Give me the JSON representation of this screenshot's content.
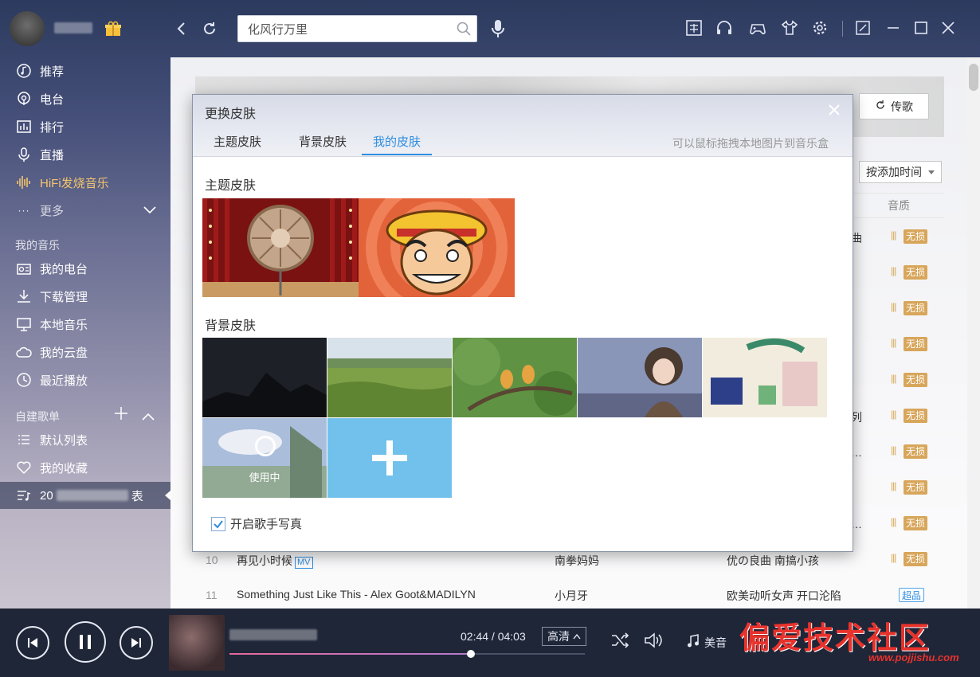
{
  "header": {
    "search_value": "化风行万里",
    "toolbar_icons": [
      "skin-icon",
      "headphone-icon",
      "gamepad-icon",
      "shirt-icon",
      "gear-icon",
      "mini-mode-icon",
      "minimize-icon",
      "maximize-icon",
      "close-icon"
    ]
  },
  "sidebar": {
    "nav": [
      {
        "label": "推荐",
        "icon": "music-disc-icon"
      },
      {
        "label": "电台",
        "icon": "radio-icon"
      },
      {
        "label": "排行",
        "icon": "chart-icon"
      },
      {
        "label": "直播",
        "icon": "mic-icon"
      },
      {
        "label": "HiFi发烧音乐",
        "icon": "waveform-icon"
      },
      {
        "label": "更多",
        "icon": "dots-icon"
      }
    ],
    "my_music_title": "我的音乐",
    "my_music": [
      {
        "label": "我的电台",
        "icon": "radio-box-icon"
      },
      {
        "label": "下载管理",
        "icon": "download-icon"
      },
      {
        "label": "本地音乐",
        "icon": "monitor-icon"
      },
      {
        "label": "我的云盘",
        "icon": "cloud-icon"
      },
      {
        "label": "最近播放",
        "icon": "clock-icon"
      }
    ],
    "playlists_title": "自建歌单",
    "playlists": [
      {
        "label": "默认列表",
        "icon": "list-icon"
      },
      {
        "label": "我的收藏",
        "icon": "heart-icon"
      },
      {
        "label": "20",
        "icon": "playlist-icon"
      }
    ],
    "playlist_tail": "表"
  },
  "main": {
    "share_label": "传歌",
    "sort_label": "按添加时间",
    "quality_header": "音质",
    "badge_lossless": "无损",
    "badge_super": "超品",
    "truncations": [
      "曲",
      "列",
      "…",
      "…"
    ],
    "tracks": [
      {
        "num": "10",
        "title": "再见小时候",
        "mv": "MV",
        "artist": "南拳妈妈",
        "album": "优の良曲 南搞小孩"
      },
      {
        "num": "11",
        "title": "Something Just Like This - Alex Goot&MADILYN",
        "mv": "",
        "artist": "小月牙",
        "album": "欧美动听女声  开口沦陷"
      }
    ]
  },
  "dialog": {
    "title": "更换皮肤",
    "tabs": [
      "主题皮肤",
      "背景皮肤",
      "我的皮肤"
    ],
    "active_tab": "我的皮肤",
    "drag_hint": "可以鼠标拖拽本地图片到音乐盒",
    "theme_section": "主题皮肤",
    "background_section": "背景皮肤",
    "using_label": "使用中",
    "singer_photo_label": "开启歌手写真",
    "singer_photo_checked": true
  },
  "player": {
    "time": "02:44 / 04:03",
    "progress": 0.68,
    "quality": "高清",
    "mei_yin": "美音"
  },
  "watermark": {
    "text": "偏爱技术社区",
    "url": "www.pojjishu.com"
  }
}
